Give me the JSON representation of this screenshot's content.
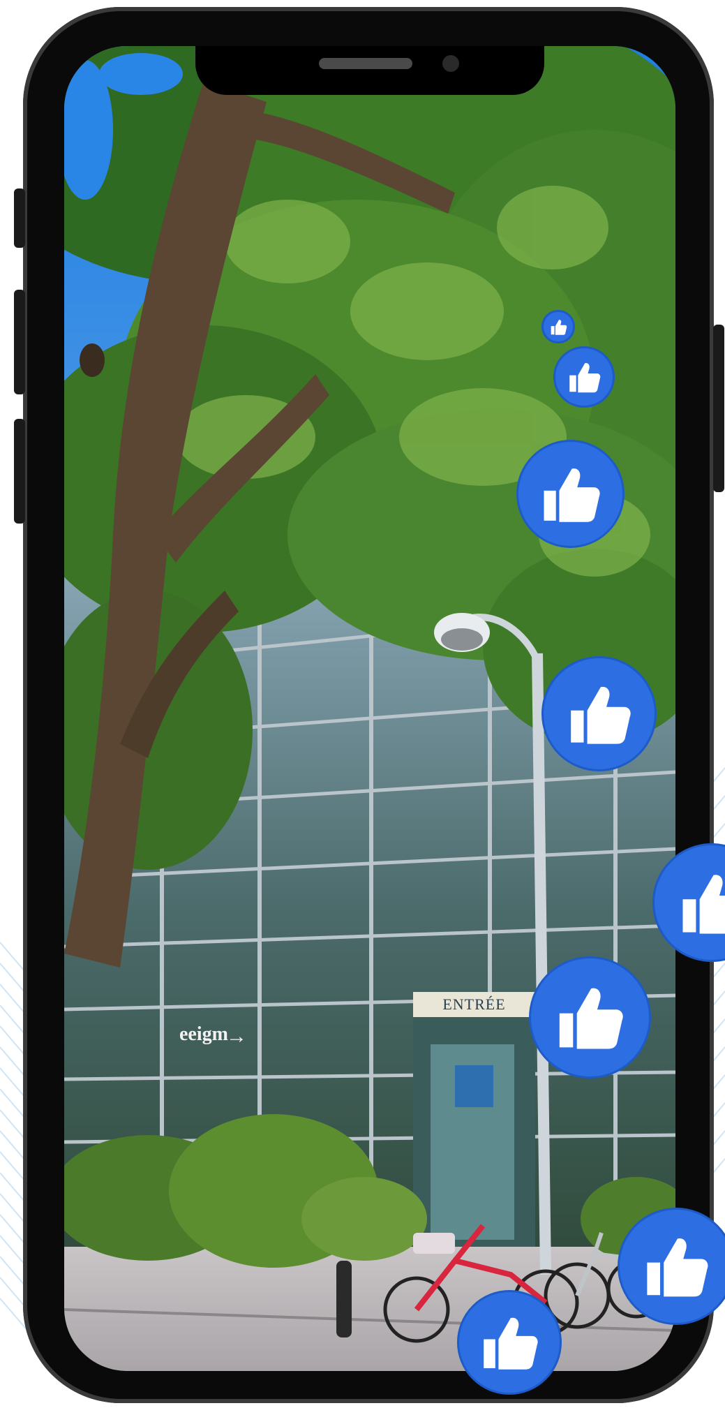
{
  "scene": {
    "entrance_sign": "ENTRÉE",
    "building_sign": "eeigm",
    "arrow_glyph": "→"
  },
  "colors": {
    "like_blue": "#2d6fe2",
    "phone_frame": "#0a0a0a",
    "sky_blue": "#1f7fe0",
    "foliage_green": "#3f7b2a"
  },
  "icons": {
    "reaction": "thumbs-up-icon"
  },
  "reactions": {
    "like_count_visible": 8
  }
}
